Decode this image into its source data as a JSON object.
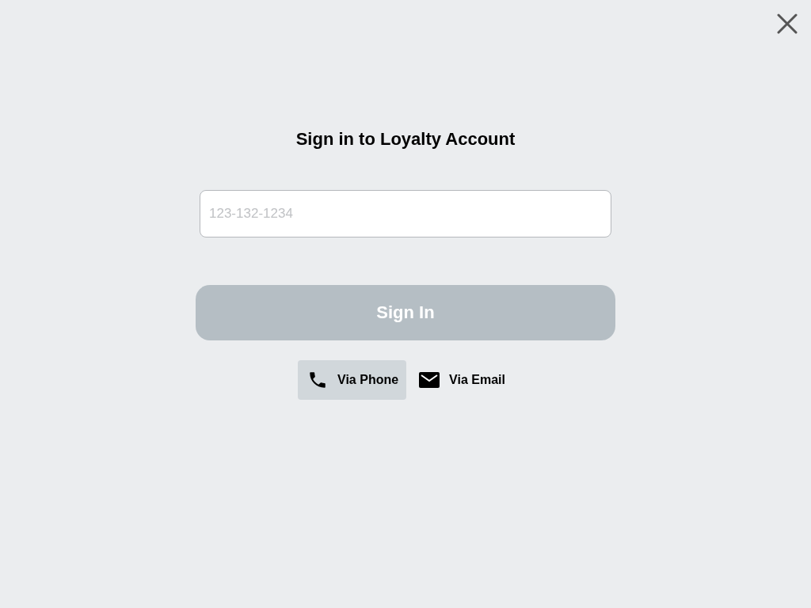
{
  "title": "Sign in to Loyalty Account",
  "phone_field": {
    "placeholder": "123-132-1234"
  },
  "sign_in_button": {
    "label": "Sign In",
    "disabled": true
  },
  "methods": [
    {
      "kind": "phone",
      "label": "Via Phone",
      "selected": true
    },
    {
      "kind": "email",
      "label": "Via Email",
      "selected": false
    }
  ]
}
